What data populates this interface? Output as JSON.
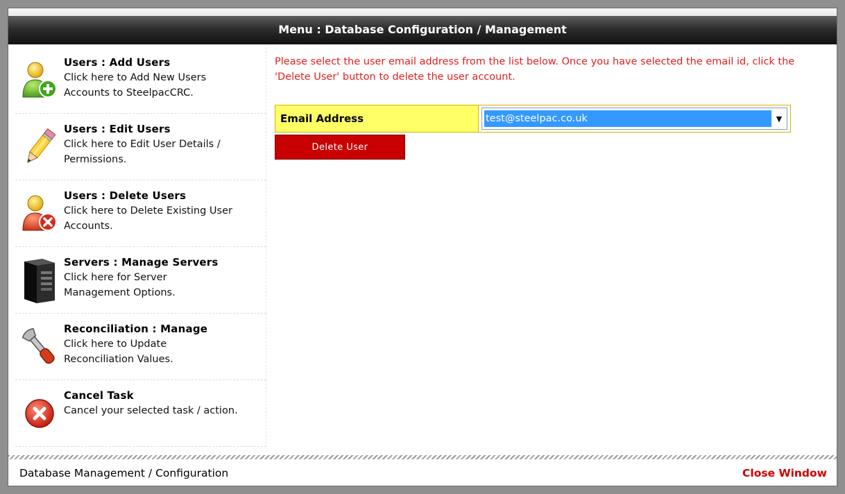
{
  "window": {
    "title": "Menu : Database Configuration / Management"
  },
  "sidebar": {
    "items": [
      {
        "icon": "add-user-icon",
        "heading": "Users : Add Users",
        "description": "Click here to Add New Users Accounts to SteelpacCRC."
      },
      {
        "icon": "pencil-icon",
        "heading": "Users : Edit Users",
        "description": "Click here to Edit User Details / Permissions."
      },
      {
        "icon": "delete-user-icon",
        "heading": "Users : Delete Users",
        "description": "Click here to Delete Existing User Accounts."
      },
      {
        "icon": "server-icon",
        "heading": "Servers : Manage Servers",
        "description": "Click here for Server Management Options."
      },
      {
        "icon": "wrench-icon",
        "heading": "Reconciliation : Manage",
        "description": "Click here to Update Reconciliation Values."
      },
      {
        "icon": "cancel-icon",
        "heading": "Cancel Task",
        "description": "Cancel your selected task / action."
      }
    ]
  },
  "main": {
    "instructions": "Please select the user email address from the list below. Once you have selected the email id, click the 'Delete User' button to delete the user account.",
    "email_label": "Email Address",
    "email_selected": "test@steelpac.co.uk",
    "delete_button": "Delete User"
  },
  "footer": {
    "left_text": "Database Management / Configuration",
    "close_link": "Close Window"
  },
  "colors": {
    "accent_red": "#cc0000",
    "label_yellow": "#ffff66",
    "selection_blue": "#3399ff"
  }
}
